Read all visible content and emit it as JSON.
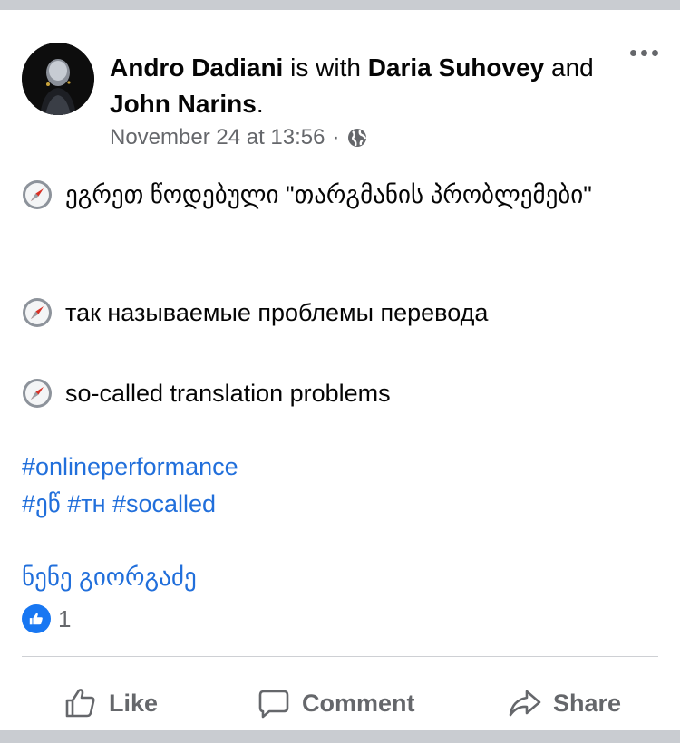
{
  "post": {
    "author": "Andro Dadiani",
    "with_text": " is with ",
    "tagged_1": "Daria  Suhovey",
    "and_text": " and ",
    "tagged_2": "John Narins",
    "period": ".",
    "timestamp": "November 24 at 13:56",
    "separator": "·",
    "privacy_icon": "globe-icon",
    "more_icon": "more-options-icon"
  },
  "content": {
    "line_ka": "ეგრეთ წოდებული \"თარგმანის პრობლემები\"",
    "line_ru": "так называемые проблемы перевода",
    "line_en": "so-called translation problems",
    "bullet_icon": "compass-icon",
    "hashtag_1": "#onlineperformance",
    "hashtags_2": "#ეწ #тн #socalled",
    "signature": "ნენე გიორგაძე"
  },
  "reactions": {
    "icon": "like-icon",
    "count": "1"
  },
  "actions": {
    "like": "Like",
    "comment": "Comment",
    "share": "Share"
  }
}
